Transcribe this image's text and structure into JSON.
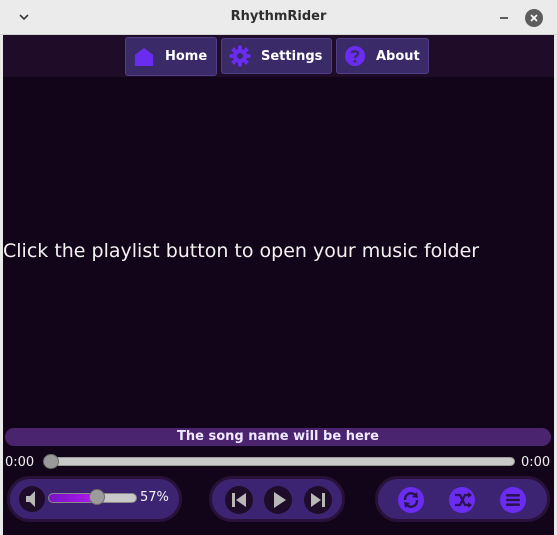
{
  "window": {
    "title": "RhythmRider"
  },
  "nav": {
    "home_label": "Home",
    "settings_label": "Settings",
    "about_label": "About"
  },
  "main": {
    "message": "Click the playlist button to open your music folder"
  },
  "player": {
    "song_name": "The song name will be here",
    "elapsed": "0:00",
    "duration": "0:00",
    "progress_fraction": 0,
    "volume_percent_text": "57%",
    "volume_fraction": 0.57
  },
  "icons": {
    "window_menu": "chevron-down-icon",
    "minimize": "minimize-icon",
    "close": "close-icon",
    "home": "home-icon",
    "settings": "gear-icon",
    "about": "question-icon",
    "volume": "speaker-icon",
    "previous": "skip-previous-icon",
    "play": "play-icon",
    "next": "skip-next-icon",
    "repeat": "repeat-icon",
    "shuffle": "shuffle-icon",
    "playlist": "playlist-icon"
  },
  "colors": {
    "background": "#130519",
    "nav_button": "#3a2a68",
    "accent_icon": "#6a2cf0",
    "song_bar": "#4a246f",
    "volume_fill": "#9a16dc"
  }
}
